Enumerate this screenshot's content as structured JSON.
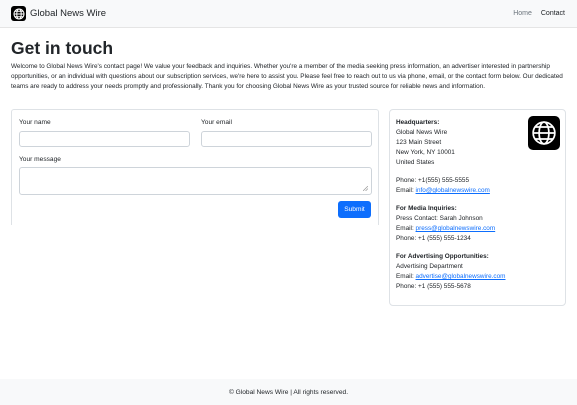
{
  "navbar": {
    "brand": "Global News Wire",
    "links": [
      {
        "label": "Home"
      },
      {
        "label": "Contact"
      }
    ]
  },
  "page": {
    "title": "Get in touch",
    "intro": "Welcome to Global News Wire's contact page! We value your feedback and inquiries. Whether you're a member of the media seeking press information, an advertiser interested in partnership opportunities, or an individual with questions about our subscription services, we're here to assist you. Please feel free to reach out to us via phone, email, or the contact form below. Our dedicated teams are ready to address your needs promptly and professionally. Thank you for choosing Global News Wire as your trusted source for reliable news and information."
  },
  "form": {
    "name_label": "Your name",
    "name_value": "",
    "email_label": "Your email",
    "email_value": "",
    "message_label": "Your message",
    "message_value": "",
    "submit_label": "Submit"
  },
  "contact": {
    "hq": {
      "heading": "Headquarters:",
      "name": "Global News Wire",
      "street": "123 Main Street",
      "city": "New York, NY 10001",
      "country": "United States",
      "phone_prefix": "Phone: ",
      "phone": "+1(555) 555-5555",
      "email_prefix": "Email: ",
      "email": "info@globalnewswire.com"
    },
    "media": {
      "heading": "For Media Inquiries:",
      "contact": "Press Contact: Sarah Johnson",
      "email_prefix": "Email: ",
      "email": "press@globalnewswire.com",
      "phone_prefix": "Phone: ",
      "phone": "+1 (555) 555-1234"
    },
    "advertising": {
      "heading": "For Advertising Opportunities:",
      "department": "Advertising Department",
      "email_prefix": "Email: ",
      "email": "advertise@globalnewswire.com",
      "phone_prefix": "Phone: ",
      "phone": "+1 (555) 555-5678"
    }
  },
  "footer": {
    "text": "© Global News Wire | All rights reserved."
  },
  "colors": {
    "primary": "#0d6efd",
    "navbar_bg": "#f8f9fa",
    "logo_bg": "#000000"
  },
  "icons": {
    "brand": "globe-icon",
    "info_logo": "globe-icon"
  }
}
